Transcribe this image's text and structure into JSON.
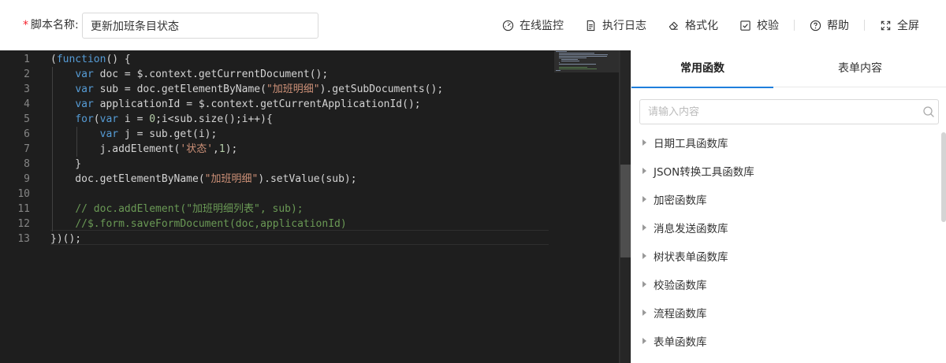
{
  "header": {
    "required_mark": "*",
    "name_label": "脚本名称:",
    "name_value": "更新加班条目状态"
  },
  "toolbar": {
    "items": [
      {
        "label": "在线监控",
        "icon": "dashboard-icon"
      },
      {
        "label": "执行日志",
        "icon": "document-icon"
      },
      {
        "label": "格式化",
        "icon": "eraser-icon"
      },
      {
        "label": "校验",
        "icon": "checkbox-icon"
      },
      {
        "label": "帮助",
        "icon": "help-circle-icon"
      },
      {
        "label": "全屏",
        "icon": "fullscreen-icon"
      }
    ]
  },
  "editor": {
    "language": "javascript",
    "theme_colors": {
      "background": "#1e1e1e",
      "keyword": "#569cd6",
      "string": "#ce9178",
      "comment": "#6a9955"
    },
    "current_line": 13,
    "lines": [
      "(function() {",
      "    var doc = $.context.getCurrentDocument();",
      "    var sub = doc.getElementByName(\"加班明细\").getSubDocuments();",
      "    var applicationId = $.context.getCurrentApplicationId();",
      "    for(var i = 0;i<sub.size();i++){",
      "        var j = sub.get(i);",
      "        j.addElement('状态',1);",
      "    }",
      "    doc.getElementByName(\"加班明细\").setValue(sub);",
      "",
      "    // doc.addElement(\"加班明细列表\", sub);",
      "    //$.form.saveFormDocument(doc,applicationId)",
      "})();"
    ]
  },
  "panel": {
    "tabs": [
      {
        "label": "常用函数",
        "active": true
      },
      {
        "label": "表单内容",
        "active": false
      }
    ],
    "search_placeholder": "请输入内容",
    "libraries": [
      "日期工具函数库",
      "JSON转换工具函数库",
      "加密函数库",
      "消息发送函数库",
      "树状表单函数库",
      "校验函数库",
      "流程函数库",
      "表单函数库"
    ],
    "accent_color": "#1e7fdc"
  }
}
